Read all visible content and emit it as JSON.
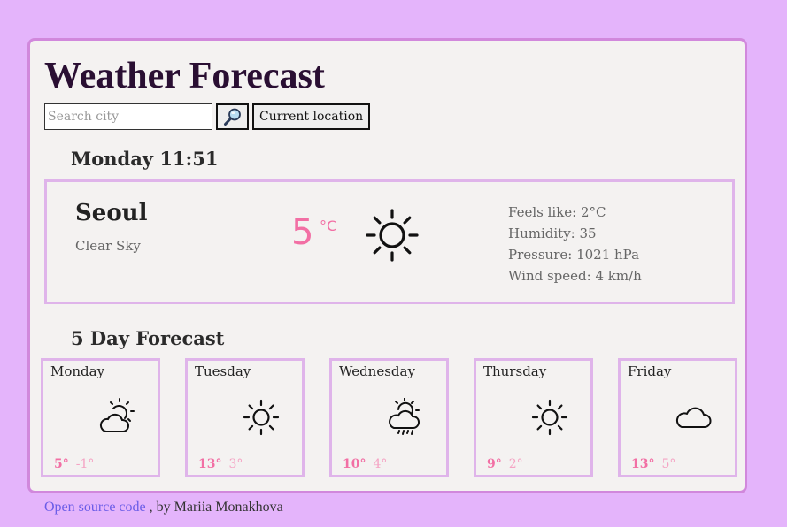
{
  "app": {
    "title": "Weather Forecast",
    "search_placeholder": "Search city",
    "search_icon": "magnifier-icon",
    "location_label": "Current location"
  },
  "current": {
    "datetime": "Monday 11:51",
    "city": "Seoul",
    "description": "Clear Sky",
    "temperature": "5",
    "unit": "°C",
    "icon": "sun-icon",
    "feels_like": "Feels like: 2°C",
    "humidity": "Humidity: 35",
    "pressure": "Pressure: 1021 hPa",
    "wind": "Wind speed: 4 km/h"
  },
  "forecast": {
    "title": "5 Day Forecast",
    "days": [
      {
        "name": "Monday",
        "icon": "partly-cloudy-icon",
        "max": "5°",
        "min": "-1°"
      },
      {
        "name": "Tuesday",
        "icon": "sun-icon",
        "max": "13°",
        "min": "3°"
      },
      {
        "name": "Wednesday",
        "icon": "sun-cloud-rain-icon",
        "max": "10°",
        "min": "4°"
      },
      {
        "name": "Thursday",
        "icon": "sun-icon",
        "max": "9°",
        "min": "2°"
      },
      {
        "name": "Friday",
        "icon": "cloud-icon",
        "max": "13°",
        "min": "5°"
      }
    ]
  },
  "footer": {
    "link_text": "Open source code",
    "author_text": ", by Mariia Monakhova"
  },
  "colors": {
    "background": "#e4b4fb",
    "card_border": "#d188dc",
    "accent_temp": "#f26fa4",
    "link": "#6a5ce7"
  }
}
